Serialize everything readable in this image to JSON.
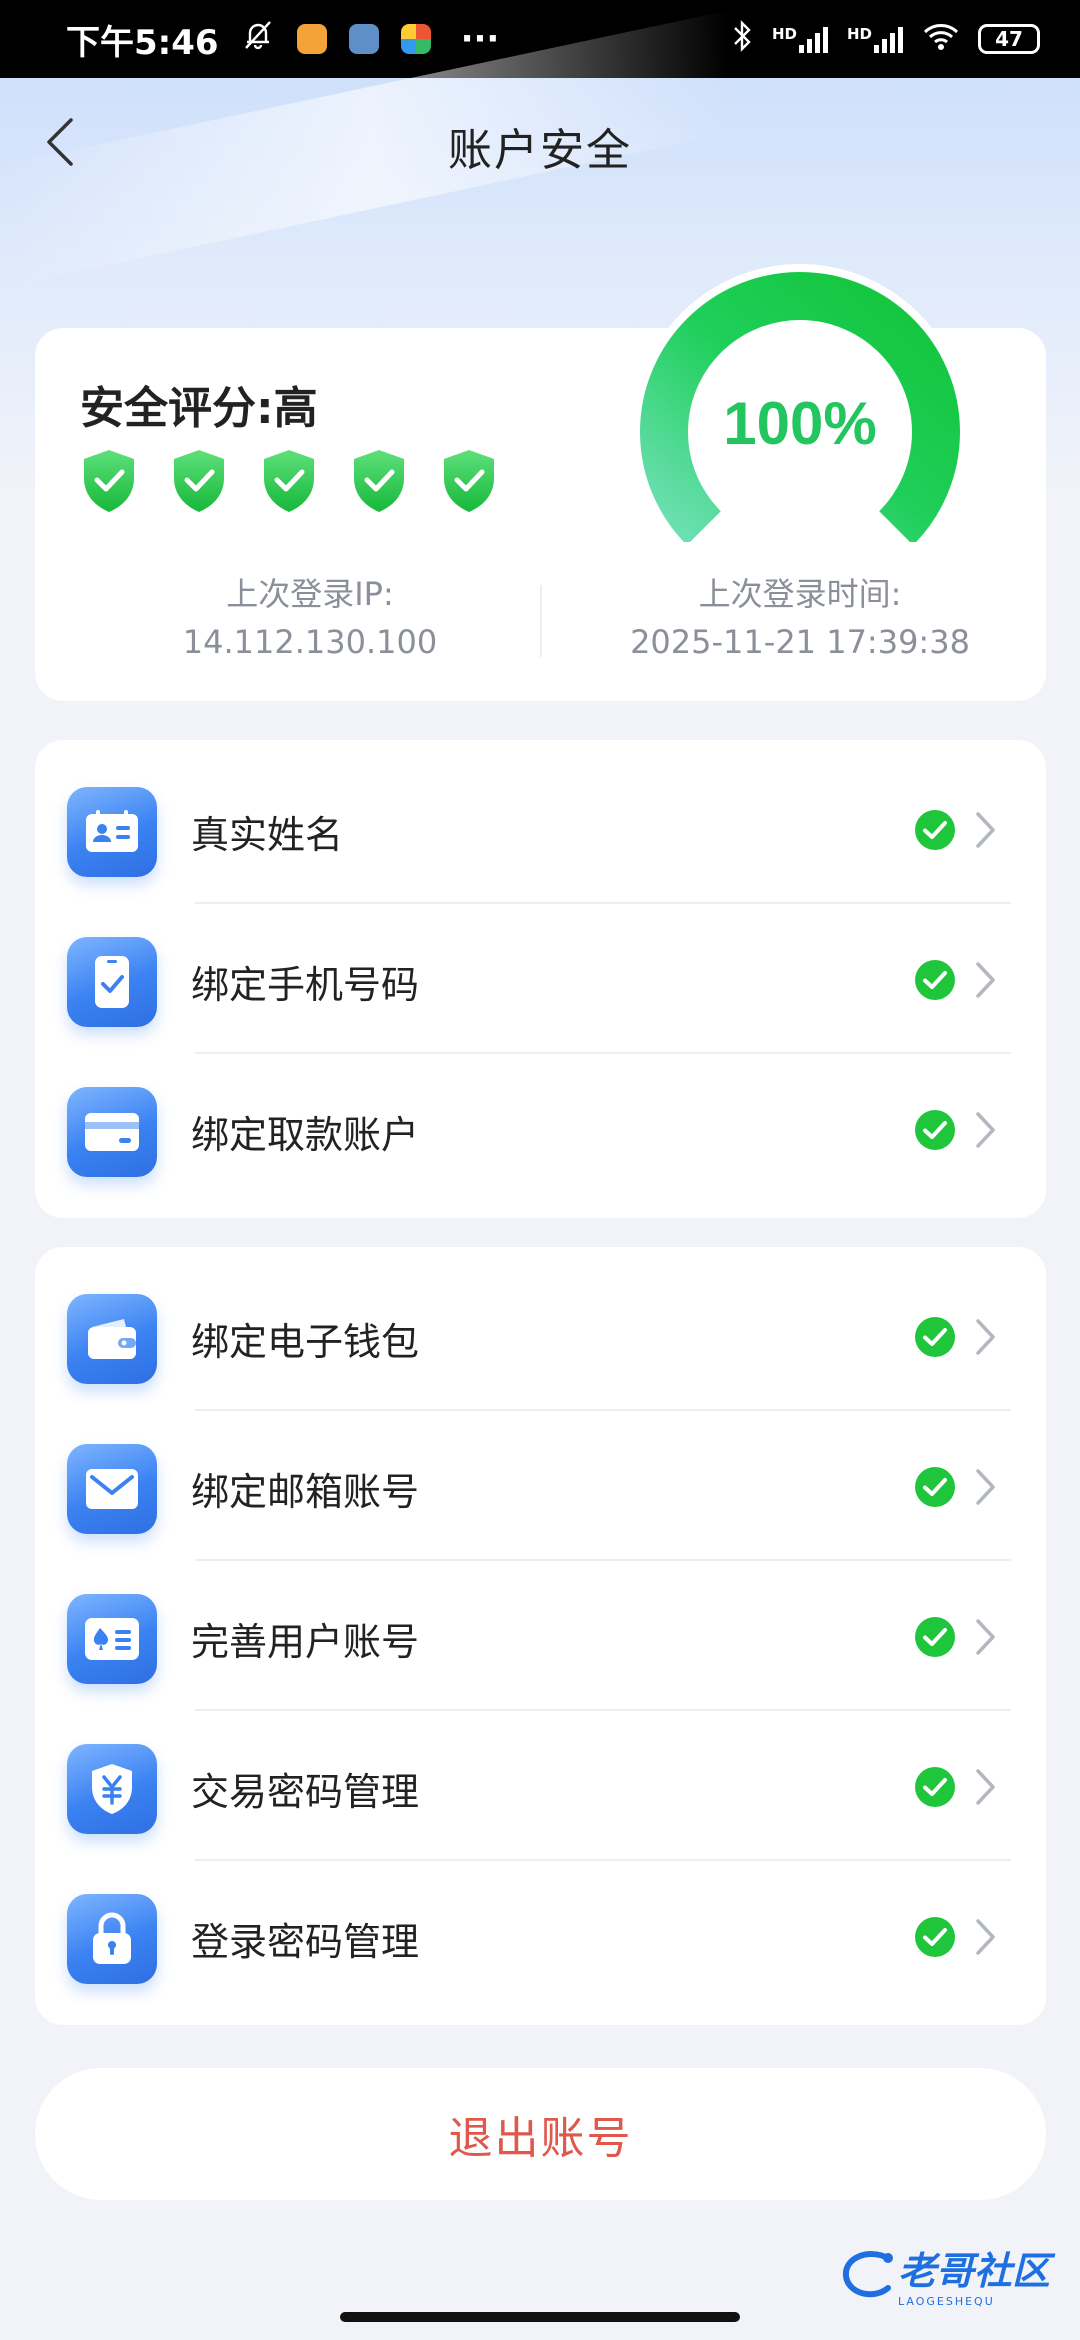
{
  "status_bar": {
    "time": "下午5:46",
    "more": "···",
    "battery": "47",
    "signal_labels": [
      "HD",
      "HD"
    ]
  },
  "nav": {
    "title": "账户安全"
  },
  "security": {
    "score_title": "安全评分:高",
    "percent": "100%",
    "percent_value": 100,
    "shield_count": 5,
    "last_ip_label": "上次登录IP:",
    "last_ip": "14.112.130.100",
    "last_time_label": "上次登录时间:",
    "last_time": "2025-11-21 17:39:38"
  },
  "group1": [
    {
      "label": "真实姓名",
      "icon": "id-card-icon",
      "verified": true
    },
    {
      "label": "绑定手机号码",
      "icon": "phone-check-icon",
      "verified": true
    },
    {
      "label": "绑定取款账户",
      "icon": "bank-card-icon",
      "verified": true
    }
  ],
  "group2": [
    {
      "label": "绑定电子钱包",
      "icon": "wallet-icon",
      "verified": true
    },
    {
      "label": "绑定邮箱账号",
      "icon": "mail-icon",
      "verified": true
    },
    {
      "label": "完善用户账号",
      "icon": "user-card-icon",
      "verified": true
    },
    {
      "label": "交易密码管理",
      "icon": "yuan-shield-icon",
      "verified": true
    },
    {
      "label": "登录密码管理",
      "icon": "lock-icon",
      "verified": true
    }
  ],
  "logout": {
    "label": "退出账号"
  },
  "watermark": {
    "text": "老哥社区",
    "sub": "LAOGESHEQU"
  },
  "colors": {
    "accent": "#2f7cf0",
    "success": "#1fc53a",
    "danger": "#e0574b"
  }
}
